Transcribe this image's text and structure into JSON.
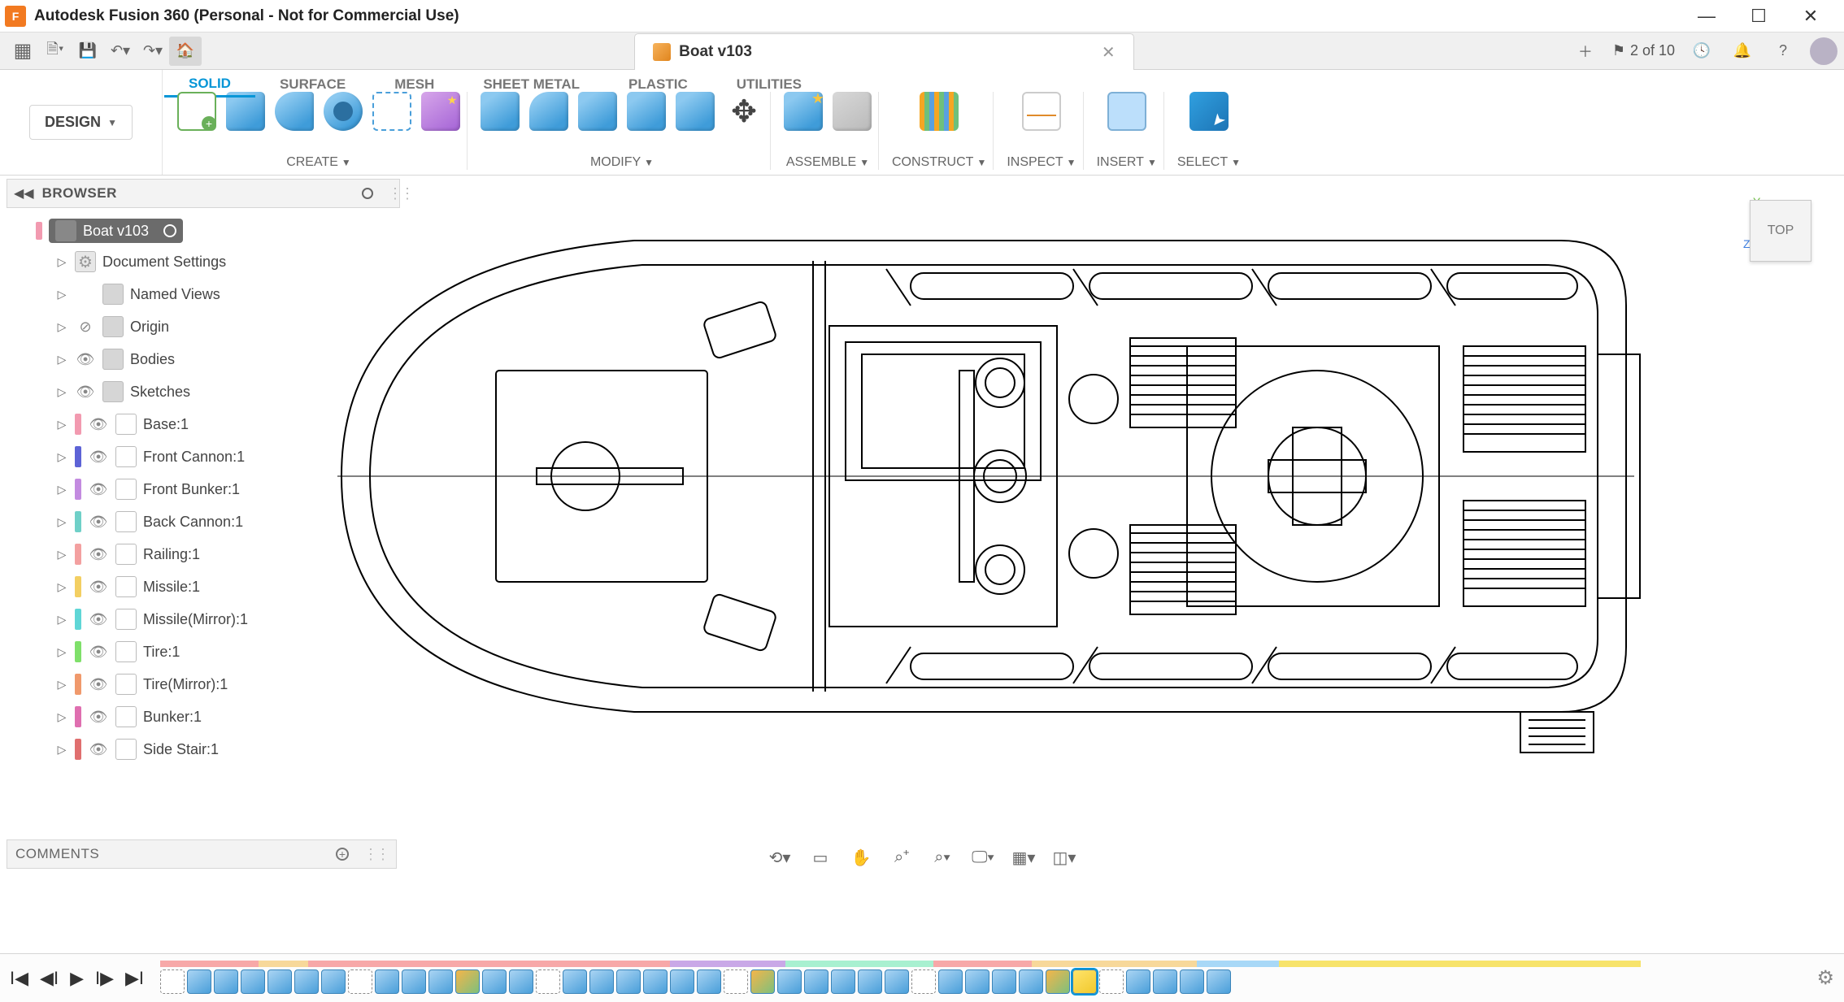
{
  "window": {
    "title": "Autodesk Fusion 360 (Personal - Not for Commercial Use)"
  },
  "quickbar": {
    "doc_tab_name": "Boat v103",
    "jobs_text": "2 of 10"
  },
  "workspace_button": "DESIGN",
  "ws_tabs": [
    "SOLID",
    "SURFACE",
    "MESH",
    "SHEET METAL",
    "PLASTIC",
    "UTILITIES"
  ],
  "ribbon_groups": {
    "create": "CREATE",
    "modify": "MODIFY",
    "assemble": "ASSEMBLE",
    "construct": "CONSTRUCT",
    "inspect": "INSPECT",
    "insert": "INSERT",
    "select": "SELECT"
  },
  "browser": {
    "header": "BROWSER",
    "root": "Boat v103",
    "items": [
      {
        "label": "Document Settings",
        "icon": "gear",
        "indent": 1,
        "color": null,
        "eye": false
      },
      {
        "label": "Named Views",
        "icon": "folder",
        "indent": 1,
        "color": null,
        "eye": false
      },
      {
        "label": "Origin",
        "icon": "folder",
        "indent": 1,
        "color": null,
        "eye": "off"
      },
      {
        "label": "Bodies",
        "icon": "folder",
        "indent": 1,
        "color": null,
        "eye": true
      },
      {
        "label": "Sketches",
        "icon": "folder",
        "indent": 1,
        "color": null,
        "eye": true
      },
      {
        "label": "Base:1",
        "icon": "comp",
        "indent": 1,
        "color": "#f29ab0",
        "eye": true
      },
      {
        "label": "Front Cannon:1",
        "icon": "comp",
        "indent": 1,
        "color": "#5d63d6",
        "eye": true
      },
      {
        "label": "Front Bunker:1",
        "icon": "comp",
        "indent": 1,
        "color": "#c38be0",
        "eye": true
      },
      {
        "label": "Back Cannon:1",
        "icon": "comp",
        "indent": 1,
        "color": "#6fd0c8",
        "eye": true
      },
      {
        "label": "Railing:1",
        "icon": "comp",
        "indent": 1,
        "color": "#f3a0a0",
        "eye": true
      },
      {
        "label": "Missile:1",
        "icon": "comp",
        "indent": 1,
        "color": "#f3cf62",
        "eye": true
      },
      {
        "label": "Missile(Mirror):1",
        "icon": "comp",
        "indent": 1,
        "color": "#5fd6d6",
        "eye": true
      },
      {
        "label": "Tire:1",
        "icon": "comp",
        "indent": 1,
        "color": "#7fe06a",
        "eye": true
      },
      {
        "label": "Tire(Mirror):1",
        "icon": "comp",
        "indent": 1,
        "color": "#f0996c",
        "eye": true
      },
      {
        "label": "Bunker:1",
        "icon": "comp",
        "indent": 1,
        "color": "#df6fb0",
        "eye": true
      },
      {
        "label": "Side Stair:1",
        "icon": "comp",
        "indent": 1,
        "color": "#e06f6f",
        "eye": true
      }
    ]
  },
  "viewcube": {
    "face": "TOP"
  },
  "comments": {
    "header": "COMMENTS"
  },
  "timeline": {
    "segments": [
      {
        "color": "#f7a8a8",
        "w": 6
      },
      {
        "color": "#f7d89a",
        "w": 3
      },
      {
        "color": "#f7a8a8",
        "w": 22
      },
      {
        "color": "#c9a8e7",
        "w": 7
      },
      {
        "color": "#a8f0d0",
        "w": 9
      },
      {
        "color": "#f7a8a8",
        "w": 6
      },
      {
        "color": "#f7d89a",
        "w": 10
      },
      {
        "color": "#a8d8f7",
        "w": 5
      },
      {
        "color": "#f7e36b",
        "w": 8
      },
      {
        "color": "#f7e36b",
        "w": 8
      },
      {
        "color": "#f7e36b",
        "w": 6
      }
    ],
    "features_count": 40
  }
}
